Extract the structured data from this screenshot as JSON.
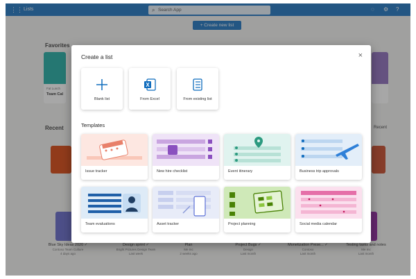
{
  "header": {
    "app_name": "Lists",
    "search_placeholder": "Search App",
    "create_button": "+ Create new list"
  },
  "background": {
    "favorites_heading": "Favorites",
    "recent_heading": "Recent",
    "right_heading": "Recent",
    "favorite_card_sub": "Fat Lunch",
    "favorite_card_title": "Team Cal",
    "lists": [
      {
        "title": "Blue Sky Ideas 2020 ✓",
        "sub1": "Contoso Team Culture",
        "sub2": "4 days ago"
      },
      {
        "title": "Design sprint ✓",
        "sub1": "Bright Pictures Design Team",
        "sub2": "Last week"
      },
      {
        "title": "Plan",
        "sub1": "Me Inc",
        "sub2": "2 weeks ago"
      },
      {
        "title": "Project Bugs ✓",
        "sub1": "Design",
        "sub2": "Last month"
      },
      {
        "title": "Monetization Prese... ✓",
        "sub1": "Contoso",
        "sub2": "Last month"
      },
      {
        "title": "Testing tasks and notes",
        "sub1": "Me Inc",
        "sub2": "Last month"
      }
    ]
  },
  "dialog": {
    "title": "Create a list",
    "close_symbol": "×",
    "start_options": [
      {
        "label": "Blank list",
        "icon": "plus-icon"
      },
      {
        "label": "From Excel",
        "icon": "excel-icon"
      },
      {
        "label": "From existing list",
        "icon": "list-icon"
      }
    ],
    "templates_heading": "Templates",
    "templates": [
      {
        "label": "Issue tracker",
        "color": "#fde7e1"
      },
      {
        "label": "New hire checklist",
        "color": "#efe3f7"
      },
      {
        "label": "Event itinerary",
        "color": "#e0f3ef"
      },
      {
        "label": "Business trip approvals",
        "color": "#e3eef9"
      },
      {
        "label": "Team evaluations",
        "color": "#deebf7"
      },
      {
        "label": "Asset tracker",
        "color": "#e8ecf8"
      },
      {
        "label": "Project planning",
        "color": "#cfe9b8"
      },
      {
        "label": "Social media calendar",
        "color": "#fbe0ee"
      }
    ]
  },
  "colors": {
    "accent": "#0f6cbd"
  }
}
